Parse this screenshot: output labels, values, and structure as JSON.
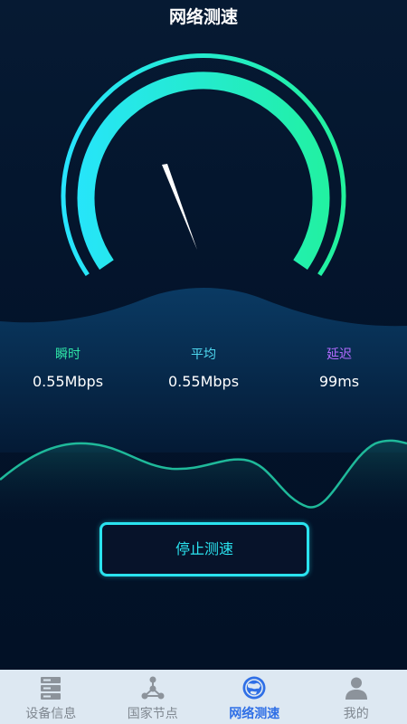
{
  "header": {
    "title": "网络测速"
  },
  "gauge": {
    "needle_fraction": 0.42,
    "color_start": "#27e4ff",
    "color_end": "#21f29a",
    "needle_color": "#ffffff"
  },
  "stats": [
    {
      "label": "瞬时",
      "value": "0.55Mbps",
      "color": "#2fe6a8"
    },
    {
      "label": "平均",
      "value": "0.55Mbps",
      "color": "#4fd8f0"
    },
    {
      "label": "延迟",
      "value": "99ms",
      "color": "#b36bff"
    }
  ],
  "actions": {
    "stop_label": "停止测速"
  },
  "tabs": [
    {
      "label": "设备信息",
      "icon": "server-icon",
      "active": false
    },
    {
      "label": "国家节点",
      "icon": "nodes-icon",
      "active": false
    },
    {
      "label": "网络测速",
      "icon": "globe-icon",
      "active": true
    },
    {
      "label": "我的",
      "icon": "person-icon",
      "active": false
    }
  ],
  "colors": {
    "accent": "#2ae3ef",
    "tab_active": "#2f6fe6",
    "tab_inactive": "#7f8790",
    "background": "#03132a"
  }
}
